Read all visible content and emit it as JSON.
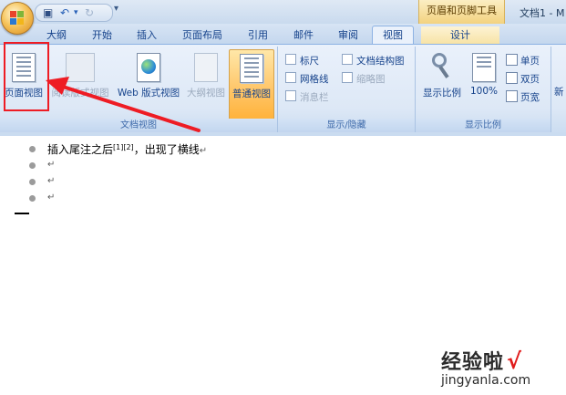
{
  "quick_access": {
    "save_icon": "save-icon",
    "undo_icon": "undo-icon",
    "redo_icon": "redo-icon",
    "customize_icon": "dropdown-icon"
  },
  "contextual_tool": "页眉和页脚工具",
  "window_title": "文档1 - M",
  "tabs": [
    {
      "label": "大纲"
    },
    {
      "label": "开始"
    },
    {
      "label": "插入"
    },
    {
      "label": "页面布局"
    },
    {
      "label": "引用"
    },
    {
      "label": "邮件"
    },
    {
      "label": "审阅"
    },
    {
      "label": "视图"
    },
    {
      "label": "设计"
    }
  ],
  "ribbon": {
    "document_views": {
      "label": "文档视图",
      "buttons": [
        {
          "label": "页面视图",
          "icon": "page-view-icon"
        },
        {
          "label": "阅读版式视图",
          "icon": "reading-layout-icon"
        },
        {
          "label": "Web 版式视图",
          "icon": "web-layout-icon"
        },
        {
          "label": "大纲视图",
          "icon": "outline-view-icon"
        },
        {
          "label": "普通视图",
          "icon": "draft-view-icon"
        }
      ]
    },
    "show_hide": {
      "label": "显示/隐藏",
      "checks": [
        {
          "label": "标尺"
        },
        {
          "label": "文档结构图"
        },
        {
          "label": "网格线"
        },
        {
          "label": "缩略图"
        },
        {
          "label": "消息栏"
        }
      ]
    },
    "zoom": {
      "label": "显示比例",
      "zoom_label": "显示比例",
      "percent_label": "100%",
      "one_page": "单页",
      "two_pages": "双页",
      "page_width": "页宽"
    },
    "next_group_label": "新"
  },
  "document": {
    "lines": [
      {
        "text": "插入尾注之后",
        "sup": "[1][2]",
        "rest": "，出现了横线",
        "mark": "↵"
      },
      {
        "mark": "↵"
      },
      {
        "mark": "↵"
      },
      {
        "mark": "↵"
      }
    ]
  },
  "watermark": {
    "brand": "经验啦",
    "check": "√",
    "url": "jingyanla.com"
  },
  "colors": {
    "highlight": "#ee1c24",
    "selected_button": "#ffc76b",
    "ribbon_bg": "#dde8f6"
  }
}
